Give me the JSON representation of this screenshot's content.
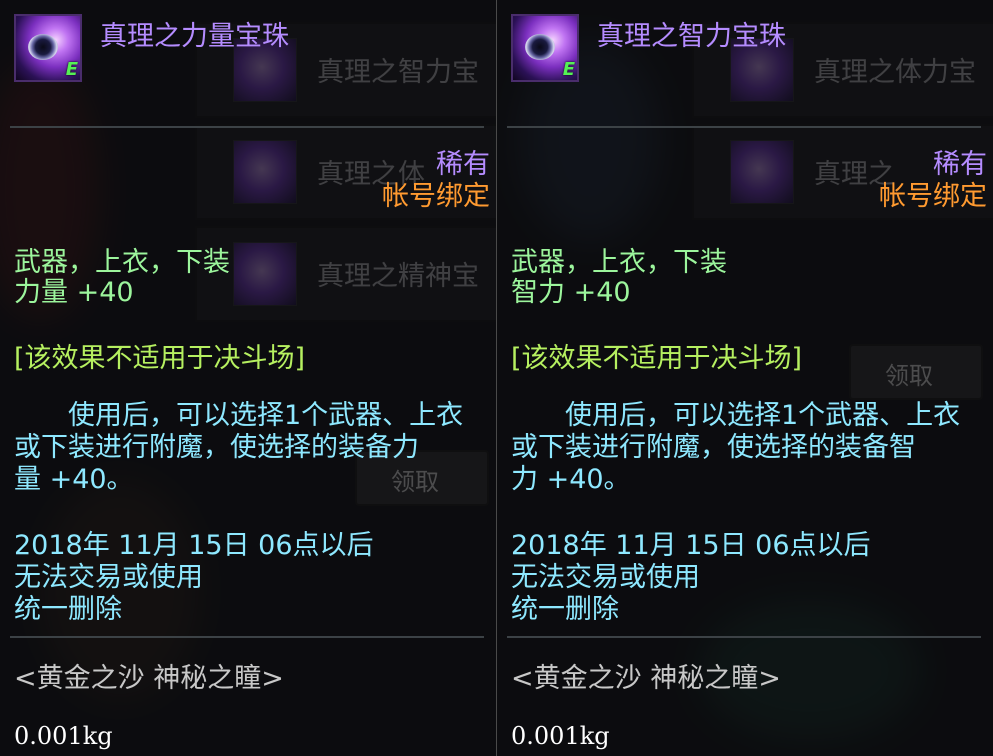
{
  "tooltips": [
    {
      "title": "真理之力量宝珠",
      "rarity": "稀有",
      "binding": "帐号绑定",
      "slots": "武器，上衣，下装",
      "stat": "力量 +40",
      "notice": "[该效果不适用于决斗场]",
      "description": [
        "　　使用后，可以选择1个武器、上衣",
        "或下装进行附魔，使选择的装备力",
        "量 +40。"
      ],
      "expire": [
        "2018年 11月 15日 06点以后",
        "无法交易或使用",
        "统一删除"
      ],
      "set": "<黄金之沙 神秘之瞳>",
      "weight": "0.001kg",
      "icon": "eye-orb-icon",
      "icon_badge": "E"
    },
    {
      "title": "真理之智力宝珠",
      "rarity": "稀有",
      "binding": "帐号绑定",
      "slots": "武器，上衣，下装",
      "stat": "智力 +40",
      "notice": "[该效果不适用于决斗场]",
      "description": [
        "　　使用后，可以选择1个武器、上衣",
        "或下装进行附魔，使选择的装备智",
        "力 +40。"
      ],
      "expire": [
        "2018年 11月 15日 06点以后",
        "无法交易或使用",
        "统一删除"
      ],
      "set": "<黄金之沙 神秘之瞳>",
      "weight": "0.001kg",
      "icon": "eye-orb-icon",
      "icon_badge": "E"
    }
  ],
  "background_list": {
    "left": [
      "真理之智力宝",
      "真理之体",
      "真理之精神宝"
    ],
    "right": [
      "真理之体力宝",
      "真理之"
    ],
    "claim_button": "领取"
  },
  "colors": {
    "title_rare": "#b58cff",
    "binding": "#ff9a30",
    "stat_green": "#9cf59c",
    "notice_green": "#b6f060",
    "desc_cyan": "#8ee8ff",
    "set_gray": "#c8c8c8",
    "weight_white": "#ffffff"
  }
}
